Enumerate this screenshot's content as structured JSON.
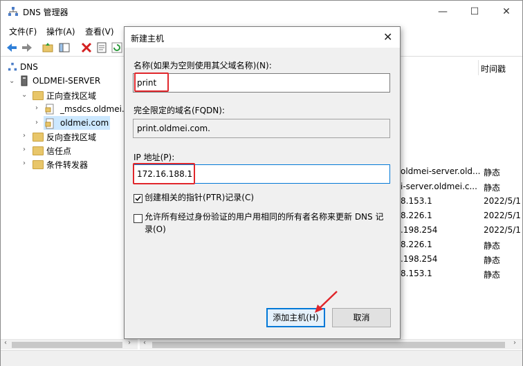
{
  "window": {
    "title": "DNS 管理器",
    "minimize": "—",
    "maximize": "☐",
    "close": "✕"
  },
  "menu": [
    "文件(F)",
    "操作(A)",
    "查看(V)"
  ],
  "tree": {
    "root": "DNS",
    "server": "OLDMEI-SERVER",
    "forward_zones": "正向查找区域",
    "msdcs": "_msdcs.oldmei.c",
    "oldmei": "oldmei.com",
    "reverse_zones": "反向查找区域",
    "trust_points": "信任点",
    "conditional_forwarders": "条件转发器"
  },
  "list": {
    "col_timestamp": "时间戳",
    "rows": [
      {
        "data": "oldmei-server.old...",
        "ts": "静态"
      },
      {
        "data": "i-server.oldmei.c...",
        "ts": "静态"
      },
      {
        "data": "8.153.1",
        "ts": "2022/5/1"
      },
      {
        "data": "8.226.1",
        "ts": "2022/5/1"
      },
      {
        "data": ".198.254",
        "ts": "2022/5/1"
      },
      {
        "data": "8.226.1",
        "ts": "静态"
      },
      {
        "data": ".198.254",
        "ts": "静态"
      },
      {
        "data": "8.153.1",
        "ts": "静态"
      }
    ]
  },
  "dialog": {
    "title": "新建主机",
    "close": "✕",
    "name_label": "名称(如果为空则使用其父域名称)(N):",
    "name_value": "print",
    "fqdn_label": "完全限定的域名(FQDN):",
    "fqdn_value": "print.oldmei.com.",
    "ip_label": "IP 地址(P):",
    "ip_value": "172.16.188.1",
    "ptr_label": "创建相关的指针(PTR)记录(C)",
    "ptr_checked": true,
    "allow_line1": "允许所有经过身份验证的用户用相同的所有者名称来更新 DNS 记",
    "allow_line2": "录(O)",
    "allow_checked": false,
    "add_button": "添加主机(H)",
    "cancel_button": "取消"
  },
  "colors": {
    "highlight": "#e0262b",
    "focus": "#0078d7",
    "selection": "#cce8ff"
  }
}
